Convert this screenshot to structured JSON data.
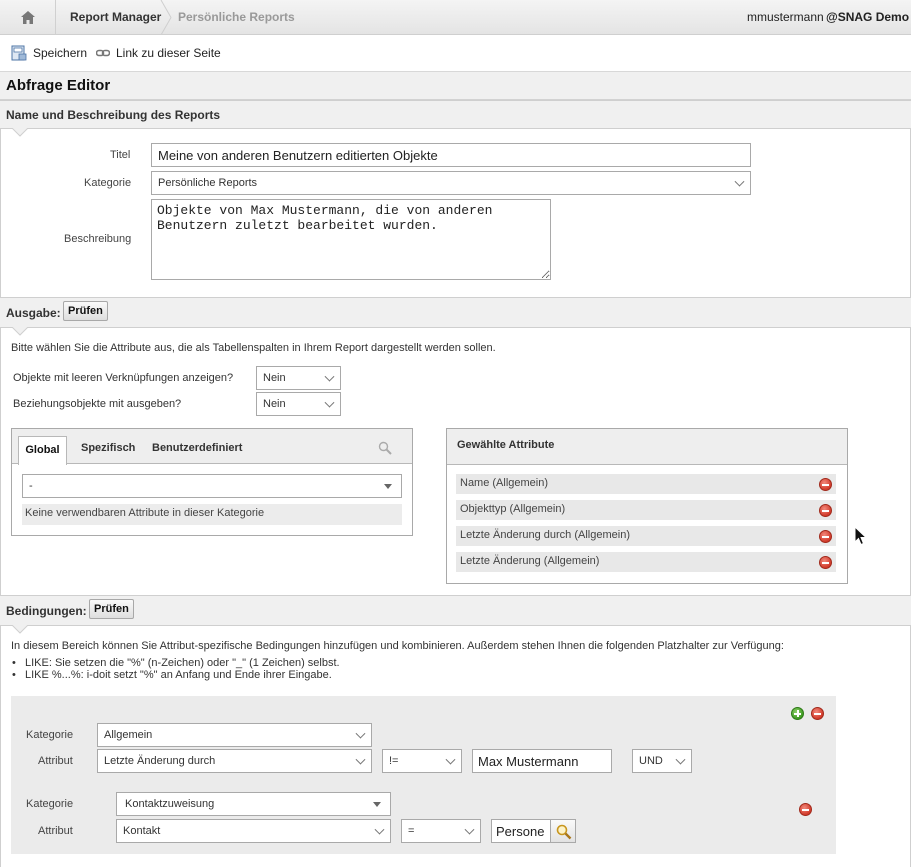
{
  "breadcrumb": {
    "items": [
      "Report Manager",
      "Persönliche Reports"
    ]
  },
  "user": {
    "name": "mmustermann",
    "tenant": "@SNAG Demo"
  },
  "toolbar": {
    "save_label": "Speichern",
    "link_label": "Link zu dieser Seite"
  },
  "page": {
    "title": "Abfrage Editor"
  },
  "name_section": {
    "heading": "Name und Beschreibung des Reports",
    "title_label": "Titel",
    "title_value": "Meine von anderen Benutzern editierten Objekte",
    "category_label": "Kategorie",
    "category_value": "Persönliche Reports",
    "description_label": "Beschreibung",
    "description_value": "Objekte von Max Mustermann, die von anderen\nBenutzern zuletzt bearbeitet wurden."
  },
  "output_section": {
    "heading": "Ausgabe:",
    "check_label": "Prüfen",
    "hint": "Bitte wählen Sie die Attribute aus, die als Tabellenspalten in Ihrem Report dargestellt werden sollen.",
    "empty_links_label": "Objekte mit leeren Verknüpfungen anzeigen?",
    "empty_links_value": "Nein",
    "relation_label": "Beziehungsobjekte mit ausgeben?",
    "relation_value": "Nein",
    "tabs": [
      {
        "label": "Global"
      },
      {
        "label": "Spezifisch"
      },
      {
        "label": "Benutzerdefiniert"
      }
    ],
    "attribute_select_value": "-",
    "no_attributes_text": "Keine verwendbaren Attribute in dieser Kategorie",
    "selected_heading": "Gewählte Attribute",
    "selected_attributes": [
      "Name (Allgemein)",
      "Objekttyp (Allgemein)",
      "Letzte Änderung durch (Allgemein)",
      "Letzte Änderung (Allgemein)"
    ]
  },
  "conditions_section": {
    "heading": "Bedingungen:",
    "check_label": "Prüfen",
    "intro": "In diesem Bereich können Sie Attribut-spezifische Bedingungen hinzufügen und kombinieren. Außerdem stehen Ihnen die folgenden Platzhalter zur Verfügung:",
    "bullets": [
      "LIKE: Sie setzen die \"%\" (n-Zeichen) oder \"_\" (1 Zeichen) selbst.",
      "LIKE %...%: i-doit setzt \"%\" an Anfang und Ende ihrer Eingabe."
    ],
    "blocks": [
      {
        "category_label": "Kategorie",
        "category_value": "Allgemein",
        "attribute_label": "Attribut",
        "attribute_value": "Letzte Änderung durch",
        "operator_value": "!=",
        "input_value": "Max Mustermann",
        "connector_value": "UND"
      },
      {
        "category_label": "Kategorie",
        "category_value": "Kontaktzuweisung",
        "attribute_label": "Attribut",
        "attribute_value": "Kontakt",
        "operator_value": "=",
        "input_value": "Persone"
      }
    ]
  },
  "colors": {
    "header_bg": "#f0f0f0",
    "border": "#cfcfcf",
    "remove_red": "#d13a2a",
    "add_green": "#3e9a22"
  }
}
